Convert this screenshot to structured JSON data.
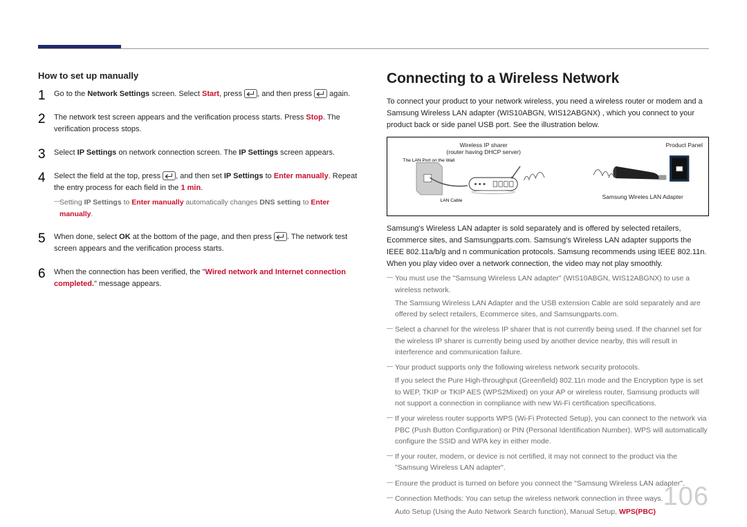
{
  "page_number": "106",
  "left": {
    "subhead": "How to set up manually",
    "steps": [
      {
        "pre": "Go to the ",
        "b1": "Network Settings",
        "mid1": " screen. Select ",
        "r1": "Start",
        "mid2": ", press ",
        "icon1": "enter",
        "mid3": ", and then press ",
        "icon2": "enter",
        "post": " again."
      },
      {
        "pre": "The network test screen appears and the verification process starts. Press ",
        "r1": "Stop",
        "post": ". The verification process stops."
      },
      {
        "pre": "Select ",
        "b1": "IP Settings",
        "mid1": " on network connection screen. The ",
        "b2": "IP Settings",
        "post": " screen appears."
      },
      {
        "pre": "Select the field at the top, press ",
        "icon1": "enter",
        "mid1": ", and then set ",
        "b1": "IP Settings",
        "mid2": " to ",
        "r1": "Enter manually",
        "mid3": ". Repeat the entry process for each field in the ",
        "r2": "1 min",
        "post": ".",
        "note": {
          "pre": "Setting ",
          "b1": "IP Settings",
          "mid1": " to ",
          "r1": "Enter manually",
          "mid2": " automatically changes ",
          "b2": "DNS setting",
          "mid3": " to ",
          "r2": "Enter manually",
          "post": "."
        }
      },
      {
        "pre": "When done, select ",
        "b1": "OK",
        "mid1": " at the bottom of the page, and then press ",
        "icon1": "enter",
        "post": ". The network test screen appears and the verification process starts."
      },
      {
        "pre": "When the connection has been verified, the \"",
        "r1": "Wired network and Internet connection completed.",
        "post": "\" message appears."
      }
    ]
  },
  "right": {
    "heading": "Connecting to a Wireless Network",
    "intro": "To connect your product to your network wireless, you need a wireless router or modem and a Samsung Wireless LAN adapter (WIS10ABGN, WIS12ABGNX) , which you connect to your product back or side panel USB port. See the illustration below.",
    "diagram": {
      "top": "Wireless IP sharer",
      "sub": "(router having DHCP server)",
      "wall": "The LAN Port on the Wall",
      "cable": "LAN Cable",
      "adapter": "Samsung Wireles LAN Adapter",
      "panel": "Product Panel"
    },
    "para2": "Samsung's Wireless LAN adapter is sold separately and is offered by selected retailers, Ecommerce sites, and Samsungparts.com. Samsung's Wireless LAN adapter supports the IEEE 802.11a/b/g and n communication protocols. Samsung recommends using IEEE 802.11n. When you play video over a network connection, the video may not play smoothly.",
    "notes": [
      {
        "text": "You must use the \"Samsung Wireless LAN adapter\" (WIS10ABGN, WIS12ABGNX) to use a wireless network.",
        "sub": "The Samsung Wireless LAN Adapter and the USB extension Cable are sold separately and are offered by select retailers, Ecommerce sites, and Samsungparts.com."
      },
      {
        "text": "Select a channel for the wireless IP sharer that is not currently being used. If the channel set for the wireless IP sharer is currently being used by another device nearby, this will result in interference and communication failure."
      },
      {
        "text": "Your product supports only the following wireless network security protocols.",
        "sub": "If you select the Pure High-throughput (Greenfield) 802.11n mode and the Encryption type is set to WEP, TKIP or TKIP AES (WPS2Mixed) on your AP or wireless router, Samsung products will not support a connection in compliance with new Wi-Fi certification specifications."
      },
      {
        "text": "If your wireless router supports WPS (Wi-Fi Protected Setup), you can connect to the network via PBC (Push Button Configuration) or PIN (Personal Identification Number). WPS will automatically configure the SSID and WPA key in either mode."
      },
      {
        "text": "If your router, modem, or device is not certified, it may not connect to the product via the \"Samsung Wireless LAN adapter\"."
      },
      {
        "text": "Ensure the product is turned on before you connect the \"Samsung Wireless LAN adapter\"."
      },
      {
        "text": "Connection Methods: You can setup the wireless network connection in three ways.",
        "sub_pre": "Auto Setup (Using the Auto Network Search function), Manual Setup, ",
        "sub_red": "WPS(PBC)"
      }
    ]
  }
}
